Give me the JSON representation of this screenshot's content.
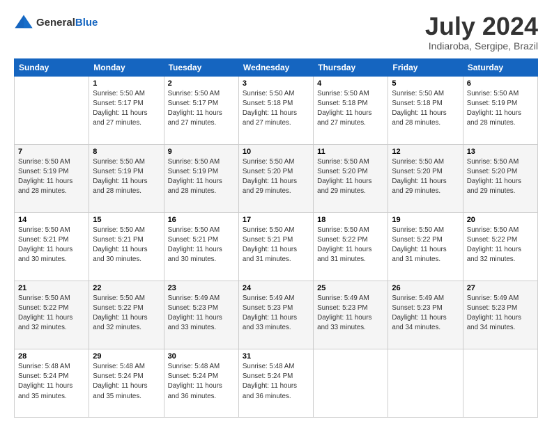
{
  "logo": {
    "general": "General",
    "blue": "Blue"
  },
  "header": {
    "title": "July 2024",
    "subtitle": "Indiaroba, Sergipe, Brazil"
  },
  "weekdays": [
    "Sunday",
    "Monday",
    "Tuesday",
    "Wednesday",
    "Thursday",
    "Friday",
    "Saturday"
  ],
  "weeks": [
    [
      {
        "day": "",
        "sunrise": "",
        "sunset": "",
        "daylight": ""
      },
      {
        "day": "1",
        "sunrise": "5:50 AM",
        "sunset": "5:17 PM",
        "daylight": "11 hours and 27 minutes."
      },
      {
        "day": "2",
        "sunrise": "5:50 AM",
        "sunset": "5:17 PM",
        "daylight": "11 hours and 27 minutes."
      },
      {
        "day": "3",
        "sunrise": "5:50 AM",
        "sunset": "5:18 PM",
        "daylight": "11 hours and 27 minutes."
      },
      {
        "day": "4",
        "sunrise": "5:50 AM",
        "sunset": "5:18 PM",
        "daylight": "11 hours and 27 minutes."
      },
      {
        "day": "5",
        "sunrise": "5:50 AM",
        "sunset": "5:18 PM",
        "daylight": "11 hours and 28 minutes."
      },
      {
        "day": "6",
        "sunrise": "5:50 AM",
        "sunset": "5:19 PM",
        "daylight": "11 hours and 28 minutes."
      }
    ],
    [
      {
        "day": "7",
        "sunrise": "5:50 AM",
        "sunset": "5:19 PM",
        "daylight": "11 hours and 28 minutes."
      },
      {
        "day": "8",
        "sunrise": "5:50 AM",
        "sunset": "5:19 PM",
        "daylight": "11 hours and 28 minutes."
      },
      {
        "day": "9",
        "sunrise": "5:50 AM",
        "sunset": "5:19 PM",
        "daylight": "11 hours and 28 minutes."
      },
      {
        "day": "10",
        "sunrise": "5:50 AM",
        "sunset": "5:20 PM",
        "daylight": "11 hours and 29 minutes."
      },
      {
        "day": "11",
        "sunrise": "5:50 AM",
        "sunset": "5:20 PM",
        "daylight": "11 hours and 29 minutes."
      },
      {
        "day": "12",
        "sunrise": "5:50 AM",
        "sunset": "5:20 PM",
        "daylight": "11 hours and 29 minutes."
      },
      {
        "day": "13",
        "sunrise": "5:50 AM",
        "sunset": "5:20 PM",
        "daylight": "11 hours and 29 minutes."
      }
    ],
    [
      {
        "day": "14",
        "sunrise": "5:50 AM",
        "sunset": "5:21 PM",
        "daylight": "11 hours and 30 minutes."
      },
      {
        "day": "15",
        "sunrise": "5:50 AM",
        "sunset": "5:21 PM",
        "daylight": "11 hours and 30 minutes."
      },
      {
        "day": "16",
        "sunrise": "5:50 AM",
        "sunset": "5:21 PM",
        "daylight": "11 hours and 30 minutes."
      },
      {
        "day": "17",
        "sunrise": "5:50 AM",
        "sunset": "5:21 PM",
        "daylight": "11 hours and 31 minutes."
      },
      {
        "day": "18",
        "sunrise": "5:50 AM",
        "sunset": "5:22 PM",
        "daylight": "11 hours and 31 minutes."
      },
      {
        "day": "19",
        "sunrise": "5:50 AM",
        "sunset": "5:22 PM",
        "daylight": "11 hours and 31 minutes."
      },
      {
        "day": "20",
        "sunrise": "5:50 AM",
        "sunset": "5:22 PM",
        "daylight": "11 hours and 32 minutes."
      }
    ],
    [
      {
        "day": "21",
        "sunrise": "5:50 AM",
        "sunset": "5:22 PM",
        "daylight": "11 hours and 32 minutes."
      },
      {
        "day": "22",
        "sunrise": "5:50 AM",
        "sunset": "5:22 PM",
        "daylight": "11 hours and 32 minutes."
      },
      {
        "day": "23",
        "sunrise": "5:49 AM",
        "sunset": "5:23 PM",
        "daylight": "11 hours and 33 minutes."
      },
      {
        "day": "24",
        "sunrise": "5:49 AM",
        "sunset": "5:23 PM",
        "daylight": "11 hours and 33 minutes."
      },
      {
        "day": "25",
        "sunrise": "5:49 AM",
        "sunset": "5:23 PM",
        "daylight": "11 hours and 33 minutes."
      },
      {
        "day": "26",
        "sunrise": "5:49 AM",
        "sunset": "5:23 PM",
        "daylight": "11 hours and 34 minutes."
      },
      {
        "day": "27",
        "sunrise": "5:49 AM",
        "sunset": "5:23 PM",
        "daylight": "11 hours and 34 minutes."
      }
    ],
    [
      {
        "day": "28",
        "sunrise": "5:48 AM",
        "sunset": "5:24 PM",
        "daylight": "11 hours and 35 minutes."
      },
      {
        "day": "29",
        "sunrise": "5:48 AM",
        "sunset": "5:24 PM",
        "daylight": "11 hours and 35 minutes."
      },
      {
        "day": "30",
        "sunrise": "5:48 AM",
        "sunset": "5:24 PM",
        "daylight": "11 hours and 36 minutes."
      },
      {
        "day": "31",
        "sunrise": "5:48 AM",
        "sunset": "5:24 PM",
        "daylight": "11 hours and 36 minutes."
      },
      {
        "day": "",
        "sunrise": "",
        "sunset": "",
        "daylight": ""
      },
      {
        "day": "",
        "sunrise": "",
        "sunset": "",
        "daylight": ""
      },
      {
        "day": "",
        "sunrise": "",
        "sunset": "",
        "daylight": ""
      }
    ]
  ],
  "labels": {
    "sunrise_prefix": "Sunrise: ",
    "sunset_prefix": "Sunset: ",
    "daylight_prefix": "Daylight: "
  }
}
